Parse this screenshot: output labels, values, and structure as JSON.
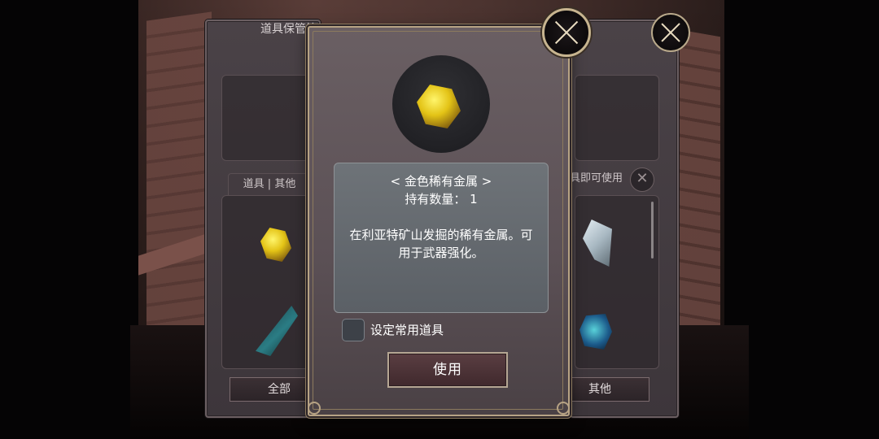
{
  "background_panel": {
    "title": "道具保管箱",
    "tab_label": "道具 | 其他",
    "right_label": "具即可使用",
    "bottom_left_button": "全部",
    "bottom_right_button": "其他",
    "small_close_glyph": "✕"
  },
  "dialog": {
    "item_name": "< 金色稀有金属 >",
    "count_label": "持有数量：  1",
    "description": "在利亚特矿山发掘的稀有金属。可用于武器强化。",
    "checkbox_label": "设定常用道具",
    "use_button": "使用"
  },
  "icons": {
    "main_item": "gold-rare-metal-icon",
    "list_items": [
      "gold-rare-metal-icon",
      "teal-crystal-icon",
      "silver-ore-icon",
      "blue-ore-icon"
    ],
    "close": "close-icon"
  },
  "colors": {
    "accent_gold_border": "#b7a384",
    "button_bg": "#4d3438",
    "dialog_bg": "#5e5357"
  }
}
